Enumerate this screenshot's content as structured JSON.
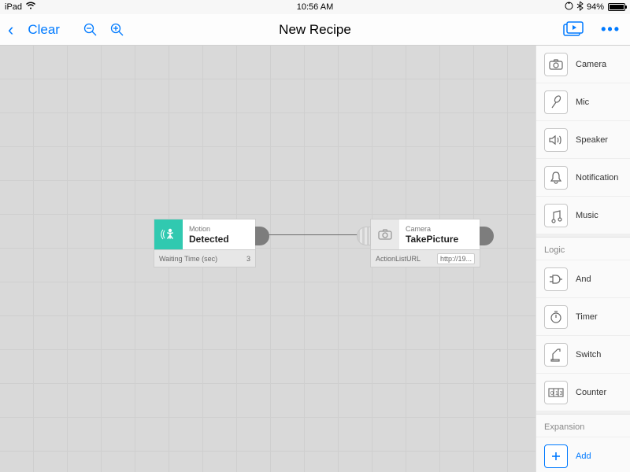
{
  "statusbar": {
    "device": "iPad",
    "time": "10:56 AM",
    "battery_pct": "94%"
  },
  "navbar": {
    "clear": "Clear",
    "title": "New Recipe"
  },
  "canvas": {
    "node1": {
      "category": "Motion",
      "name": "Detected",
      "param_label": "Waiting Time (sec)",
      "param_value": "3"
    },
    "node2": {
      "category": "Camera",
      "name": "TakePicture",
      "param_label": "ActionListURL",
      "param_value": "http://19..."
    }
  },
  "sidebar": {
    "items": [
      {
        "label": "Camera"
      },
      {
        "label": "Mic"
      },
      {
        "label": "Speaker"
      },
      {
        "label": "Notification"
      },
      {
        "label": "Music"
      }
    ],
    "logic_header": "Logic",
    "logic": [
      {
        "label": "And"
      },
      {
        "label": "Timer"
      },
      {
        "label": "Switch"
      },
      {
        "label": "Counter"
      }
    ],
    "expansion_header": "Expansion",
    "expansion": {
      "label": "Add"
    }
  }
}
